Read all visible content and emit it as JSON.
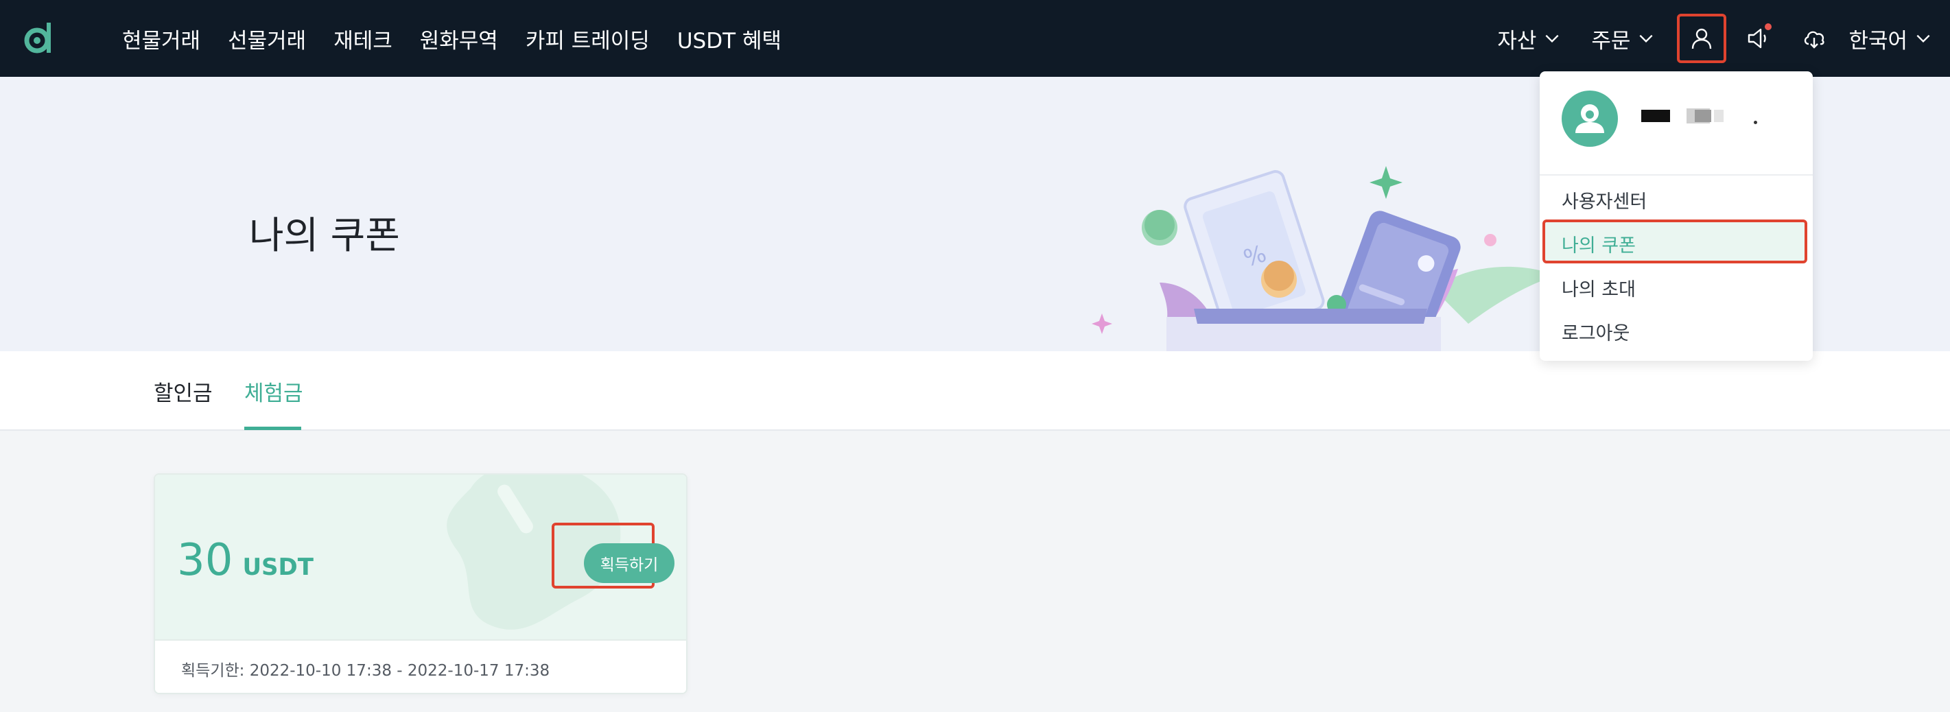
{
  "nav": {
    "logo_icon": "d-logo-icon",
    "links": [
      "현물거래",
      "선물거래",
      "재테크",
      "원화무역",
      "카피 트레이딩",
      "USDT 혜택"
    ],
    "assets_label": "자산",
    "orders_label": "주문",
    "language_label": "한국어",
    "icons": [
      "user-icon",
      "announcement-icon",
      "download-icon",
      "chevron-down-icon"
    ]
  },
  "hero": {
    "title": "나의 쿠폰"
  },
  "tabs": [
    {
      "label": "할인금",
      "active": false
    },
    {
      "label": "체험금",
      "active": true
    }
  ],
  "coupon": {
    "amount": "30",
    "unit": "USDT",
    "claim_label": "획득하기",
    "period": "획득기한: 2022-10-10 17:38 - 2022-10-17 17:38"
  },
  "user_menu": {
    "items": [
      "사용자센터",
      "나의 쿠폰",
      "나의 초대",
      "로그아웃"
    ],
    "active_item": "나의 쿠폰"
  },
  "colors": {
    "nav_bg": "#0f1a26",
    "accent": "#3fae95",
    "highlight_box": "#e0432f",
    "hero_bg": "#eff2f9"
  }
}
